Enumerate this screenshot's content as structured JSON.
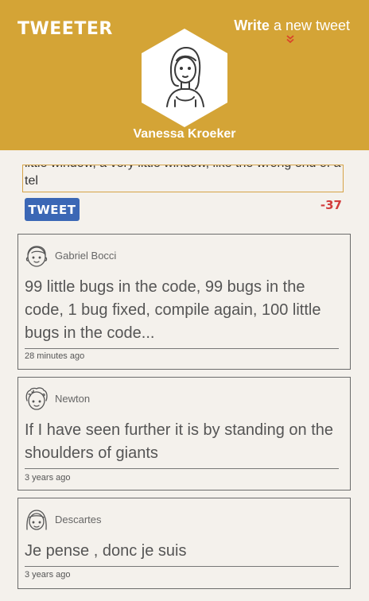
{
  "header": {
    "brand": "TWEETER",
    "write_bold": "Write",
    "write_rest": " a new tweet",
    "username": "Vanessa Kroeker",
    "background": "#d4a436"
  },
  "compose": {
    "text": "field, and the edges go dark and nothing is left but a little window, a very little window, like the wrong end of a tel",
    "button_label": "TWEET",
    "char_counter": "-37"
  },
  "tweets": [
    {
      "author": "Gabriel Bocci",
      "text": "99 little bugs in the code, 99 bugs in the code, 1 bug fixed, compile again, 100 little bugs in the code...",
      "time": "28 minutes ago",
      "avatar_icon": "man-face-icon"
    },
    {
      "author": "Newton",
      "text": "If I have seen further it is by standing on the shoulders of giants",
      "time": "3 years ago",
      "avatar_icon": "curly-hair-face-icon"
    },
    {
      "author": "Descartes",
      "text": "Je pense , donc je suis",
      "time": "3 years ago",
      "avatar_icon": "long-hair-face-icon"
    }
  ],
  "colors": {
    "accent": "#d4a436",
    "button": "#3b67b5",
    "counter": "#d23c3c"
  }
}
